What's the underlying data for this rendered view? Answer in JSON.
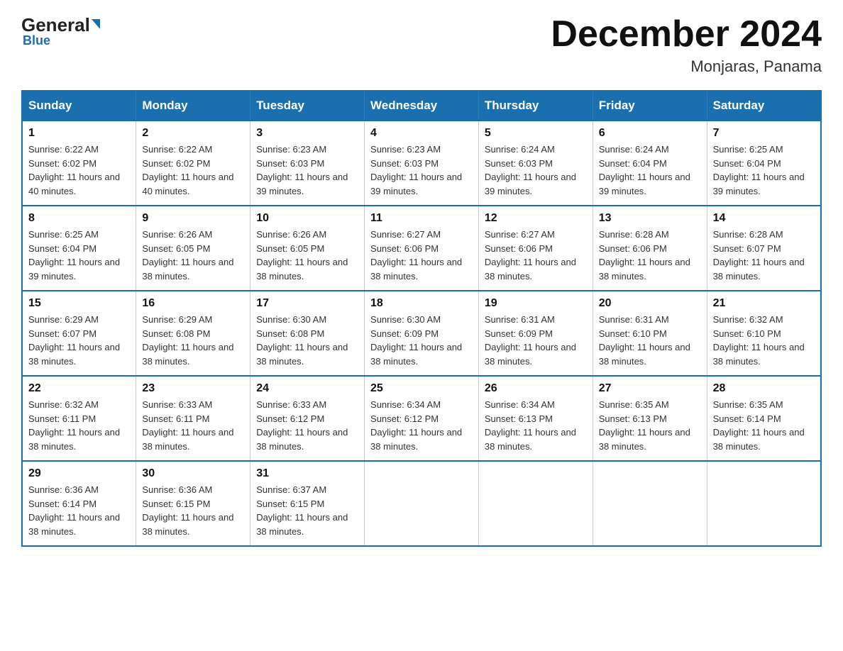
{
  "logo": {
    "general": "General",
    "blue": "Blue",
    "triangle": "▲"
  },
  "header": {
    "month": "December 2024",
    "location": "Monjaras, Panama"
  },
  "days_of_week": [
    "Sunday",
    "Monday",
    "Tuesday",
    "Wednesday",
    "Thursday",
    "Friday",
    "Saturday"
  ],
  "weeks": [
    [
      {
        "day": "1",
        "sunrise": "6:22 AM",
        "sunset": "6:02 PM",
        "daylight": "11 hours and 40 minutes."
      },
      {
        "day": "2",
        "sunrise": "6:22 AM",
        "sunset": "6:02 PM",
        "daylight": "11 hours and 40 minutes."
      },
      {
        "day": "3",
        "sunrise": "6:23 AM",
        "sunset": "6:03 PM",
        "daylight": "11 hours and 39 minutes."
      },
      {
        "day": "4",
        "sunrise": "6:23 AM",
        "sunset": "6:03 PM",
        "daylight": "11 hours and 39 minutes."
      },
      {
        "day": "5",
        "sunrise": "6:24 AM",
        "sunset": "6:03 PM",
        "daylight": "11 hours and 39 minutes."
      },
      {
        "day": "6",
        "sunrise": "6:24 AM",
        "sunset": "6:04 PM",
        "daylight": "11 hours and 39 minutes."
      },
      {
        "day": "7",
        "sunrise": "6:25 AM",
        "sunset": "6:04 PM",
        "daylight": "11 hours and 39 minutes."
      }
    ],
    [
      {
        "day": "8",
        "sunrise": "6:25 AM",
        "sunset": "6:04 PM",
        "daylight": "11 hours and 39 minutes."
      },
      {
        "day": "9",
        "sunrise": "6:26 AM",
        "sunset": "6:05 PM",
        "daylight": "11 hours and 38 minutes."
      },
      {
        "day": "10",
        "sunrise": "6:26 AM",
        "sunset": "6:05 PM",
        "daylight": "11 hours and 38 minutes."
      },
      {
        "day": "11",
        "sunrise": "6:27 AM",
        "sunset": "6:06 PM",
        "daylight": "11 hours and 38 minutes."
      },
      {
        "day": "12",
        "sunrise": "6:27 AM",
        "sunset": "6:06 PM",
        "daylight": "11 hours and 38 minutes."
      },
      {
        "day": "13",
        "sunrise": "6:28 AM",
        "sunset": "6:06 PM",
        "daylight": "11 hours and 38 minutes."
      },
      {
        "day": "14",
        "sunrise": "6:28 AM",
        "sunset": "6:07 PM",
        "daylight": "11 hours and 38 minutes."
      }
    ],
    [
      {
        "day": "15",
        "sunrise": "6:29 AM",
        "sunset": "6:07 PM",
        "daylight": "11 hours and 38 minutes."
      },
      {
        "day": "16",
        "sunrise": "6:29 AM",
        "sunset": "6:08 PM",
        "daylight": "11 hours and 38 minutes."
      },
      {
        "day": "17",
        "sunrise": "6:30 AM",
        "sunset": "6:08 PM",
        "daylight": "11 hours and 38 minutes."
      },
      {
        "day": "18",
        "sunrise": "6:30 AM",
        "sunset": "6:09 PM",
        "daylight": "11 hours and 38 minutes."
      },
      {
        "day": "19",
        "sunrise": "6:31 AM",
        "sunset": "6:09 PM",
        "daylight": "11 hours and 38 minutes."
      },
      {
        "day": "20",
        "sunrise": "6:31 AM",
        "sunset": "6:10 PM",
        "daylight": "11 hours and 38 minutes."
      },
      {
        "day": "21",
        "sunrise": "6:32 AM",
        "sunset": "6:10 PM",
        "daylight": "11 hours and 38 minutes."
      }
    ],
    [
      {
        "day": "22",
        "sunrise": "6:32 AM",
        "sunset": "6:11 PM",
        "daylight": "11 hours and 38 minutes."
      },
      {
        "day": "23",
        "sunrise": "6:33 AM",
        "sunset": "6:11 PM",
        "daylight": "11 hours and 38 minutes."
      },
      {
        "day": "24",
        "sunrise": "6:33 AM",
        "sunset": "6:12 PM",
        "daylight": "11 hours and 38 minutes."
      },
      {
        "day": "25",
        "sunrise": "6:34 AM",
        "sunset": "6:12 PM",
        "daylight": "11 hours and 38 minutes."
      },
      {
        "day": "26",
        "sunrise": "6:34 AM",
        "sunset": "6:13 PM",
        "daylight": "11 hours and 38 minutes."
      },
      {
        "day": "27",
        "sunrise": "6:35 AM",
        "sunset": "6:13 PM",
        "daylight": "11 hours and 38 minutes."
      },
      {
        "day": "28",
        "sunrise": "6:35 AM",
        "sunset": "6:14 PM",
        "daylight": "11 hours and 38 minutes."
      }
    ],
    [
      {
        "day": "29",
        "sunrise": "6:36 AM",
        "sunset": "6:14 PM",
        "daylight": "11 hours and 38 minutes."
      },
      {
        "day": "30",
        "sunrise": "6:36 AM",
        "sunset": "6:15 PM",
        "daylight": "11 hours and 38 minutes."
      },
      {
        "day": "31",
        "sunrise": "6:37 AM",
        "sunset": "6:15 PM",
        "daylight": "11 hours and 38 minutes."
      },
      null,
      null,
      null,
      null
    ]
  ]
}
